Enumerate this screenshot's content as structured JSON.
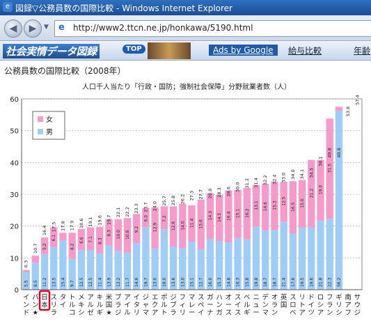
{
  "window": {
    "title": "図録▽公務員数の国際比較 - Windows Internet Explorer"
  },
  "address_bar": {
    "url": "http://www2.ttcn.ne.jp/honkawa/5190.html"
  },
  "site_bar": {
    "logo": "社会実情データ図録",
    "top_label": "TOP",
    "ads_label": "Ads by Google",
    "link_1": "給与比較",
    "link_2": "年齢"
  },
  "page": {
    "heading": "公務員数の国際比較（2008年）"
  },
  "colors": {
    "female": "#f59ac9",
    "male": "#9fcdf5",
    "highlight_border": "#e0002a"
  },
  "chart_data": {
    "type": "bar",
    "stacked": true,
    "title": "人口千人当たり「行政・国防；強制社会保障」分野就業者数（人）",
    "ylim": [
      0,
      60
    ],
    "yticks": [
      0,
      10,
      20,
      30,
      40,
      50,
      60
    ],
    "grid": true,
    "legend_position": "top-left",
    "series": [
      {
        "name": "女",
        "values": [
          0.7,
          2.2,
          5.2,
          6.1,
          2.5,
          8.2,
          6.6,
          7.1,
          8.3,
          8.3,
          10.0,
          10.8,
          9.2,
          6.0,
          12.9,
          7.2,
          12.6,
          14.0,
          11.4,
          15.6,
          14.3,
          14.5,
          16.4,
          15.1,
          16.2,
          13.1,
          14.6,
          15.3,
          12.5,
          16.5,
          15.0,
          21.2,
          19.0,
          31.5,
          1.3
        ]
      },
      {
        "name": "男",
        "values": [
          5.5,
          8.5,
          11.2,
          13.5,
          15.4,
          9.7,
          12.5,
          12.5,
          11.4,
          13.9,
          12.2,
          11.7,
          14.6,
          19.7,
          13.0,
          19.0,
          13.6,
          13.0,
          15.1,
          12.7,
          16.0,
          15.3,
          14.8,
          16.3,
          15.8,
          19.8,
          18.7,
          18.7,
          21.4,
          17.6,
          19.5,
          19.6,
          21.8,
          22.3,
          56.2
        ]
      }
    ],
    "totals": [
      6.3,
      10.7,
      16.4,
      17.5,
      17.8,
      17.9,
      18.6,
      19.1,
      19.6,
      19.7,
      22.1,
      22.2,
      23.3,
      23.7,
      24.0,
      25.7,
      25.8,
      26.2,
      27.3,
      27.7,
      28.0,
      28.3,
      28.6,
      30.0,
      31.2,
      31.4,
      32.2,
      32.4,
      33.0,
      34.0,
      34.1,
      34.5,
      38.1,
      40.8,
      40.8,
      53.8,
      57.4
    ],
    "categories": [
      "インド",
      "バングラデシュ★",
      "日本",
      "スリランカ",
      "タイ",
      "トルコ",
      "メキシコ",
      "アルゼンチン",
      "キルギス",
      "米国★",
      "ブラジル",
      "アイルランド",
      "イタリア",
      "ジャマイカ",
      "エクアドル",
      "ポルトガル",
      "ジブラルタル",
      "フィリピン",
      "マレーシア",
      "スペイン",
      "ガーナ",
      "ハンガリー",
      "オーストラリア",
      "スイス",
      "ベルギー",
      "ニュージーランド",
      "デンマーク",
      "オランダ",
      "英国",
      "スロベニア",
      "リトアニア",
      "ドイツ",
      "ロシア",
      "フランス",
      "ギリシャ",
      "南アフリカ",
      "サウジアラビア"
    ],
    "label_chars": [
      "インド",
      "バン★",
      "日本",
      "スリラ",
      "タイ",
      "トルコ",
      "メキシ",
      "アルゼ",
      "キルギ",
      "米国★",
      "ブラジ",
      "アイル",
      "イタリ",
      "ジャマ",
      "エクア",
      "ポルト",
      "ジブラ",
      "フィリ",
      "マレー",
      "スペイ",
      "ガーナ",
      "ハンガ",
      "オース",
      "スイス",
      "ベルギ",
      "ニュー",
      "デンマ",
      "オラン",
      "英国",
      "スロベ",
      "リトア",
      "ドイツ",
      "ロシア",
      "フラン",
      "ギリシ",
      "南アフ",
      "サウジ"
    ]
  }
}
